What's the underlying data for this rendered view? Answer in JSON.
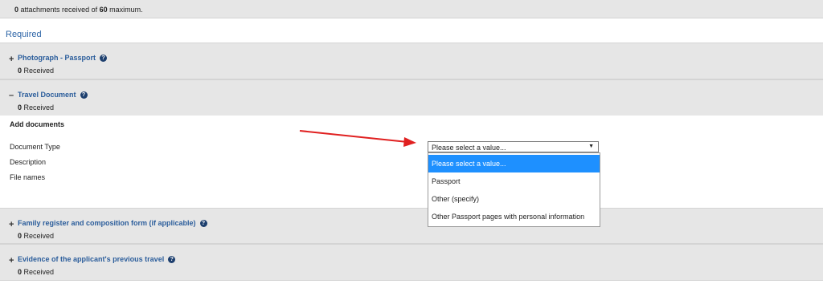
{
  "summary": {
    "count": "0",
    "text1": "attachments received of",
    "max": "60",
    "text2": "maximum."
  },
  "required_heading": "Required",
  "help_glyph": "?",
  "items": [
    {
      "symbol": "+",
      "title": "Photograph - Passport",
      "received_count": "0",
      "received_label": "Received"
    },
    {
      "symbol": "–",
      "title": "Travel Document",
      "received_count": "0",
      "received_label": "Received"
    },
    {
      "symbol": "+",
      "title": "Family register and composition form (if applicable)",
      "received_count": "0",
      "received_label": "Received"
    },
    {
      "symbol": "+",
      "title": "Evidence of the applicant's previous travel",
      "received_count": "0",
      "received_label": "Received"
    }
  ],
  "panel": {
    "heading": "Add documents",
    "document_type_label": "Document Type",
    "description_label": "Description",
    "file_names_label": "File names"
  },
  "select": {
    "value": "Please select a value...",
    "caret": "▼",
    "options": [
      "Please select a value...",
      "Passport",
      "Other (specify)",
      "Other Passport pages with personal information"
    ]
  },
  "colors": {
    "link": "#2b5d9b",
    "highlight": "#1e90ff",
    "arrow": "#e02020",
    "band": "#e6e6e6"
  }
}
